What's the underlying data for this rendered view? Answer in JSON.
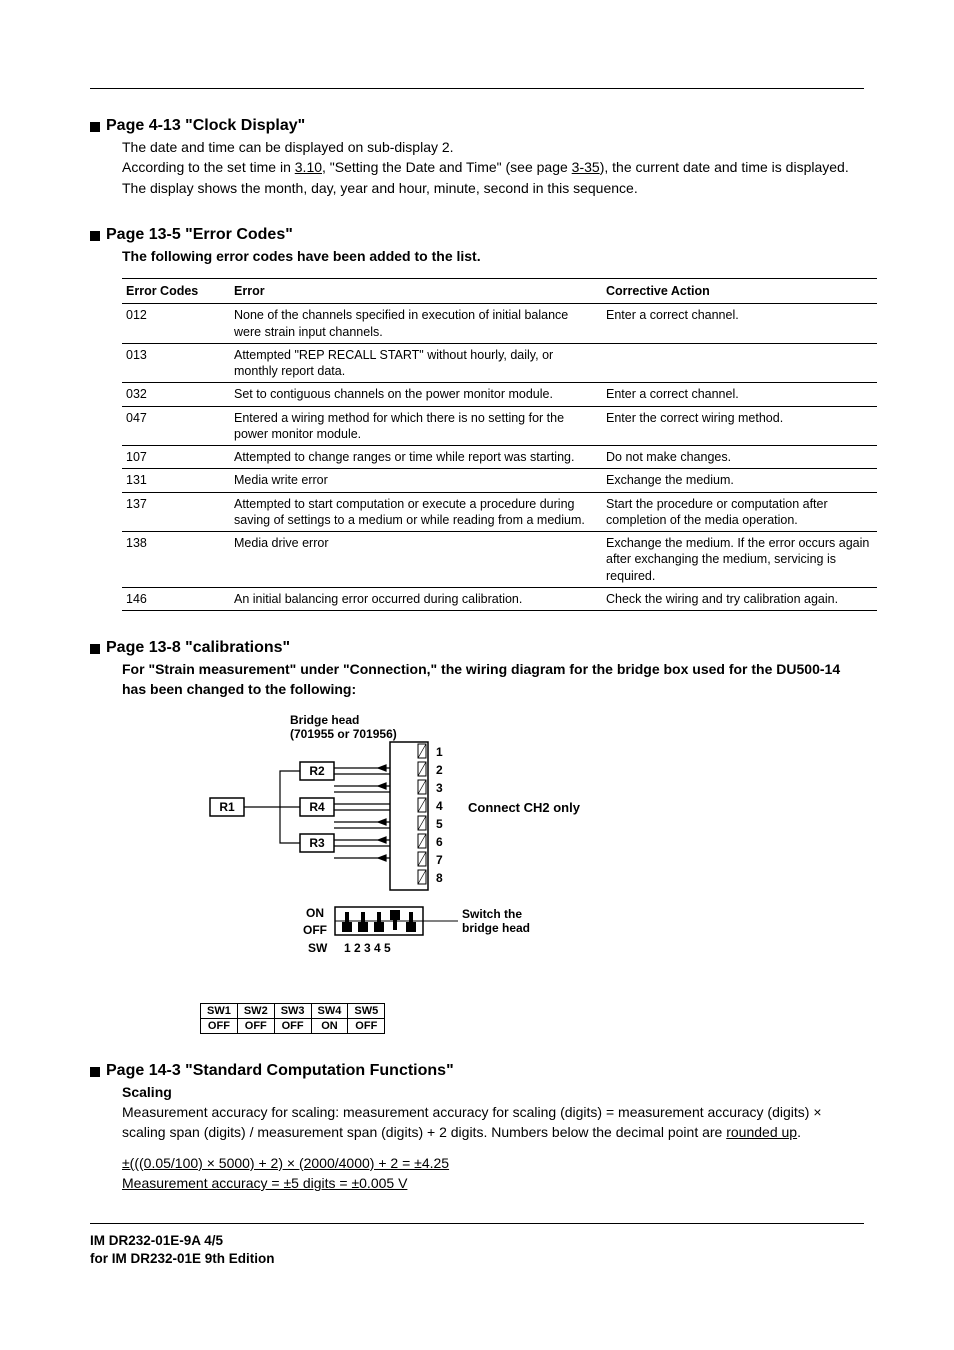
{
  "sec1": {
    "title": "Page 4-13  \"Clock Display\"",
    "p1_a": "The date and time can be displayed on sub-display 2.",
    "p2_a": "According to the set time in ",
    "p2_u1": "3.10",
    "p2_b": ", \"Setting the Date and Time\" (see page ",
    "p2_u2": "3-35",
    "p2_c": "), the current date and time is displayed.",
    "p3": "The display shows the month, day, year and hour, minute, second in this sequence."
  },
  "sec2": {
    "title": "Page 13-5  \"Error Codes\"",
    "sub": "The following error codes have been added to the list.",
    "headers": {
      "c1": "Error Codes",
      "c2": "Error",
      "c3": "Corrective Action"
    },
    "rows": [
      {
        "code": "012",
        "error": "None of the channels specified in execution of initial balance were strain input channels.",
        "action": "Enter a correct channel."
      },
      {
        "code": "013",
        "error": "Attempted \"REP RECALL START\" without hourly, daily, or monthly report data.",
        "action": ""
      },
      {
        "code": "032",
        "error": "Set to contiguous channels on the power monitor module.",
        "action": "Enter a correct channel."
      },
      {
        "code": "047",
        "error": "Entered a wiring method for which there is no setting for the power monitor module.",
        "action": "Enter the correct wiring method."
      },
      {
        "code": "107",
        "error": "Attempted to change ranges or time while report was starting.",
        "action": "Do not make changes."
      },
      {
        "code": "131",
        "error": "Media write error",
        "action": "Exchange the medium."
      },
      {
        "code": "137",
        "error": "Attempted to start computation or execute a procedure during saving of settings to a medium or while reading from a medium.",
        "action": "Start the procedure or computation after completion of the media operation."
      },
      {
        "code": "138",
        "error": "Media drive error",
        "action": "Exchange the medium. If the error occurs again after exchanging the medium, servicing is required."
      },
      {
        "code": "146",
        "error": "An initial balancing error occurred during calibration.",
        "action": "Check the wiring and try calibration again."
      }
    ]
  },
  "sec3": {
    "title": "Page 13-8  \"calibrations\"",
    "sub": "For \"Strain measurement\" under \"Connection,\" the wiring diagram for the bridge box used for the DU500-14 has been changed to the following:",
    "diag": {
      "bridge_head_l1": "Bridge head",
      "bridge_head_l2": "(701955 or 701956)",
      "r1": "R1",
      "r2": "R2",
      "r3": "R3",
      "r4": "R4",
      "nums": [
        "1",
        "2",
        "3",
        "4",
        "5",
        "6",
        "7",
        "8"
      ],
      "connect": "Connect CH2 only",
      "switch_l1": "Switch the",
      "switch_l2": "bridge head",
      "on": "ON",
      "off": "OFF",
      "sw": "SW",
      "swnums": "1  2  3  4  5",
      "swh": [
        "SW1",
        "SW2",
        "SW3",
        "SW4",
        "SW5"
      ],
      "swv": [
        "OFF",
        "OFF",
        "OFF",
        "ON",
        "OFF"
      ]
    }
  },
  "sec4": {
    "title": "Page 14-3  \"Standard Computation Functions\"",
    "sub": "Scaling",
    "p1_a": "Measurement accuracy for scaling: measurement accuracy for scaling (digits) = measurement accuracy (digits) × scaling span (digits) / measurement span (digits) + 2 digits. Numbers below the decimal point are ",
    "p1_u": "rounded up",
    "p1_b": ".",
    "eq1": "±(((0.05/100) × 5000) + 2) × (2000/4000) + 2 = ±4.25",
    "eq2": "Measurement accuracy = ±5 digits = ±0.005 V"
  },
  "footer": {
    "l1": "IM DR232-01E-9A  4/5",
    "l2": "for IM DR232-01E 9th Edition"
  }
}
